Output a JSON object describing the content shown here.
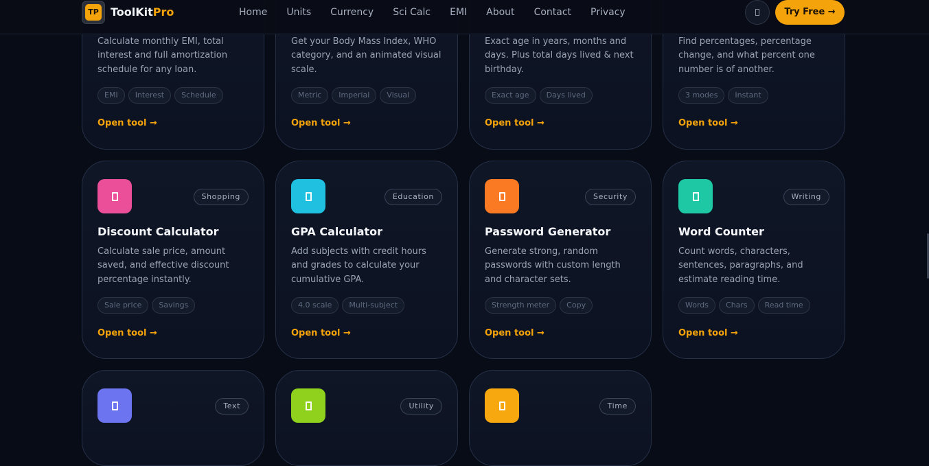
{
  "header": {
    "logo_text": "TP",
    "brand_main": "ToolKit",
    "brand_accent": "Pro",
    "nav": [
      "Home",
      "Units",
      "Currency",
      "Sci Calc",
      "EMI",
      "About",
      "Contact",
      "Privacy"
    ],
    "theme_icon": "moon-icon",
    "cta_label": "Try Free →"
  },
  "colors": {
    "accent": "#f5a30b",
    "background": "#080c16",
    "card_border": "#253047"
  },
  "cards": [
    {
      "title": "",
      "category": "",
      "description": "Calculate monthly EMI, total interest and full amortization schedule for any loan.",
      "tags": [
        "EMI",
        "Interest",
        "Schedule"
      ],
      "link": "Open tool →"
    },
    {
      "title": "",
      "category": "",
      "description": "Get your Body Mass Index, WHO category, and an animated visual scale.",
      "tags": [
        "Metric",
        "Imperial",
        "Visual"
      ],
      "link": "Open tool →"
    },
    {
      "title": "",
      "category": "",
      "description": "Exact age in years, months and days. Plus total days lived & next birthday.",
      "tags": [
        "Exact age",
        "Days lived"
      ],
      "link": "Open tool →"
    },
    {
      "title": "",
      "category": "",
      "description": "Find percentages, percentage change, and what percent one number is of another.",
      "tags": [
        "3 modes",
        "Instant"
      ],
      "link": "Open tool →"
    },
    {
      "title": "Discount Calculator",
      "category": "Shopping",
      "icon_color": "#ec4f9a",
      "description": "Calculate sale price, amount saved, and effective discount percentage instantly.",
      "tags": [
        "Sale price",
        "Savings"
      ],
      "link": "Open tool →"
    },
    {
      "title": "GPA Calculator",
      "category": "Education",
      "icon_color": "#1fc0e0",
      "description": "Add subjects with credit hours and grades to calculate your cumulative GPA.",
      "tags": [
        "4.0 scale",
        "Multi-subject"
      ],
      "link": "Open tool →"
    },
    {
      "title": "Password Generator",
      "category": "Security",
      "icon_color": "#f97a22",
      "description": "Generate strong, random passwords with custom length and character sets.",
      "tags": [
        "Strength meter",
        "Copy"
      ],
      "link": "Open tool →"
    },
    {
      "title": "Word Counter",
      "category": "Writing",
      "icon_color": "#1ec8a4",
      "description": "Count words, characters, sentences, paragraphs, and estimate reading time.",
      "tags": [
        "Words",
        "Chars",
        "Read time"
      ],
      "link": "Open tool →"
    },
    {
      "title": "",
      "category": "Text",
      "icon_color": "#6c74f0",
      "description": "",
      "tags": [],
      "link": ""
    },
    {
      "title": "",
      "category": "Utility",
      "icon_color": "#8fd11c",
      "description": "",
      "tags": [],
      "link": ""
    },
    {
      "title": "",
      "category": "Time",
      "icon_color": "#f7a80f",
      "description": "",
      "tags": [],
      "link": ""
    }
  ]
}
